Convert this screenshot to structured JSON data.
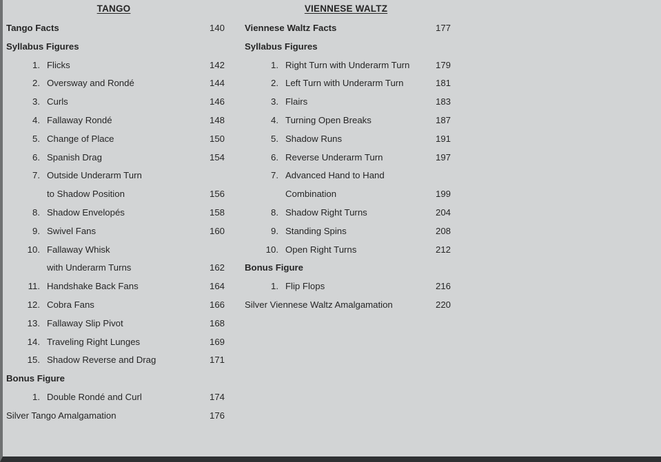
{
  "page": {
    "background_color": "#d2d4d5",
    "text_color": "#262626",
    "border_color": "#6f7172"
  },
  "columns": [
    {
      "id": "tango",
      "heading": "TANGO",
      "entries": [
        {
          "type": "top",
          "num": "",
          "title": "Tango Facts",
          "page": "140"
        },
        {
          "type": "heading",
          "num": "",
          "title": "Syllabus Figures",
          "page": ""
        },
        {
          "type": "item",
          "num": "1.",
          "title": "Flicks",
          "page": "142"
        },
        {
          "type": "item",
          "num": "2.",
          "title": "Oversway and Rondé",
          "page": "144"
        },
        {
          "type": "item",
          "num": "3.",
          "title": "Curls",
          "page": "146"
        },
        {
          "type": "item",
          "num": "4.",
          "title": "Fallaway Rondé",
          "page": "148"
        },
        {
          "type": "item",
          "num": "5.",
          "title": "Change of Place",
          "page": "150"
        },
        {
          "type": "item",
          "num": "6.",
          "title": "Spanish Drag",
          "page": "154"
        },
        {
          "type": "itemnl",
          "num": "7.",
          "title": "Outside Underarm Turn",
          "page": ""
        },
        {
          "type": "cont",
          "num": "",
          "title": "to Shadow Position",
          "page": "156"
        },
        {
          "type": "item",
          "num": "8.",
          "title": "Shadow Envelopés",
          "page": "158"
        },
        {
          "type": "item",
          "num": "9.",
          "title": "Swivel Fans",
          "page": "160"
        },
        {
          "type": "itemnl",
          "num": "10.",
          "title": "Fallaway Whisk",
          "page": ""
        },
        {
          "type": "cont",
          "num": "",
          "title": "with Underarm Turns",
          "page": "162"
        },
        {
          "type": "item",
          "num": "11.",
          "title": "Handshake Back Fans",
          "page": "164"
        },
        {
          "type": "item",
          "num": "12.",
          "title": "Cobra Fans",
          "page": "166"
        },
        {
          "type": "item",
          "num": "13.",
          "title": "Fallaway Slip Pivot",
          "page": "168"
        },
        {
          "type": "item",
          "num": "14.",
          "title": "Traveling Right Lunges",
          "page": "169"
        },
        {
          "type": "item",
          "num": "15.",
          "title": "Shadow Reverse and Drag",
          "page": "171"
        },
        {
          "type": "heading",
          "num": "",
          "title": "Bonus Figure",
          "page": ""
        },
        {
          "type": "item",
          "num": "1.",
          "title": "Double Rondé and Curl",
          "page": "174"
        },
        {
          "type": "flush",
          "num": "",
          "title": "Silver Tango Amalgamation",
          "page": "176"
        }
      ]
    },
    {
      "id": "viennese-waltz",
      "heading": "VIENNESE WALTZ",
      "entries": [
        {
          "type": "top",
          "num": "",
          "title": "Viennese Waltz Facts",
          "page": "177"
        },
        {
          "type": "heading",
          "num": "",
          "title": "Syllabus Figures",
          "page": ""
        },
        {
          "type": "item",
          "num": "1.",
          "title": "Right Turn with Underarm Turn",
          "page": "179"
        },
        {
          "type": "item",
          "num": "2.",
          "title": "Left Turn with Underarm Turn",
          "page": "181"
        },
        {
          "type": "item",
          "num": "3.",
          "title": "Flairs",
          "page": "183"
        },
        {
          "type": "item",
          "num": "4.",
          "title": "Turning Open Breaks",
          "page": "187"
        },
        {
          "type": "item",
          "num": "5.",
          "title": "Shadow Runs",
          "page": "191"
        },
        {
          "type": "item",
          "num": "6.",
          "title": "Reverse Underarm Turn",
          "page": "197"
        },
        {
          "type": "itemnl",
          "num": "7.",
          "title": "Advanced Hand to Hand",
          "page": ""
        },
        {
          "type": "cont",
          "num": "",
          "title": "Combination",
          "page": "199"
        },
        {
          "type": "item",
          "num": "8.",
          "title": "Shadow Right Turns",
          "page": "204"
        },
        {
          "type": "item",
          "num": "9.",
          "title": "Standing Spins",
          "page": "208"
        },
        {
          "type": "item",
          "num": "10.",
          "title": "Open Right Turns",
          "page": "212"
        },
        {
          "type": "heading",
          "num": "",
          "title": "Bonus Figure",
          "page": ""
        },
        {
          "type": "item",
          "num": "1.",
          "title": "Flip Flops",
          "page": "216"
        },
        {
          "type": "flush",
          "num": "",
          "title": "Silver Viennese Waltz Amalgamation",
          "page": "220"
        }
      ]
    }
  ]
}
